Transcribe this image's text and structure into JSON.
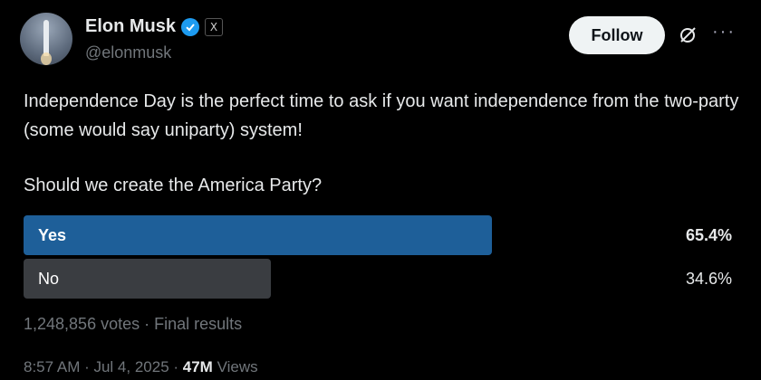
{
  "author": {
    "name": "Elon Musk",
    "handle": "@elonmusk",
    "verified": true
  },
  "header": {
    "follow_label": "Follow",
    "more_label": "···"
  },
  "tweet": {
    "text": "Independence Day is the perfect time to ask if you want independence from the two-party (some would say uniparty) system!",
    "question": "Should we create the America Party?"
  },
  "poll": {
    "options": [
      {
        "label": "Yes",
        "percent_text": "65.4%",
        "percent": 65.4,
        "color": "#1e5f99",
        "winner": true
      },
      {
        "label": "No",
        "percent_text": "34.6%",
        "percent": 34.6,
        "color": "#3a3d41",
        "winner": false
      }
    ],
    "summary": "1,248,856 votes · Final results"
  },
  "meta": {
    "time_date": "8:57 AM · Jul 4, 2025 · ",
    "views_count": "47M",
    "views_label": " Views"
  },
  "colors": {
    "background": "#000000",
    "accent": "#1d9bf0",
    "secondary_text": "#71767b"
  }
}
